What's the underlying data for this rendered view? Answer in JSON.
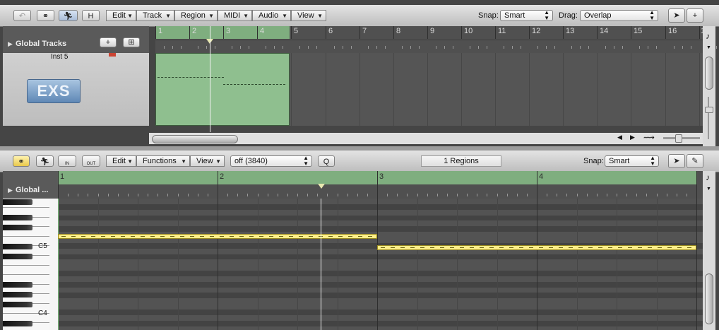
{
  "arrange": {
    "toolbar": {
      "menus": [
        "Edit",
        "Track",
        "Region",
        "MIDI",
        "Audio",
        "View"
      ],
      "h_button": "H",
      "snap_label": "Snap:",
      "snap_value": "Smart",
      "drag_label": "Drag:",
      "drag_value": "Overlap"
    },
    "global_tracks_label": "Global Tracks",
    "add_track_glyph": "+",
    "track": {
      "name": "Inst 5",
      "plugin": "EXS"
    },
    "bar_numbers": [
      "1",
      "2",
      "3",
      "4",
      "5",
      "6",
      "7",
      "8",
      "9",
      "10",
      "11",
      "12",
      "13",
      "14",
      "15",
      "16",
      "1"
    ],
    "note_icon": "♪"
  },
  "piano_roll": {
    "toolbar": {
      "in_label": "IN",
      "out_label": "OUT",
      "menus": [
        "Edit",
        "Functions",
        "View"
      ],
      "quantize_value": "off (3840)",
      "q_button": "Q",
      "regions_label": "1 Regions",
      "snap_label": "Snap:",
      "snap_value": "Smart"
    },
    "global_label": "Global ...",
    "bar_numbers": [
      "1",
      "2",
      "3",
      "4"
    ],
    "key_labels": [
      "C5",
      "C4"
    ]
  },
  "colors": {
    "region_green": "#8fbf8f",
    "note_yellow": "#ffef8a",
    "cycle_green": "#7fae7f"
  }
}
